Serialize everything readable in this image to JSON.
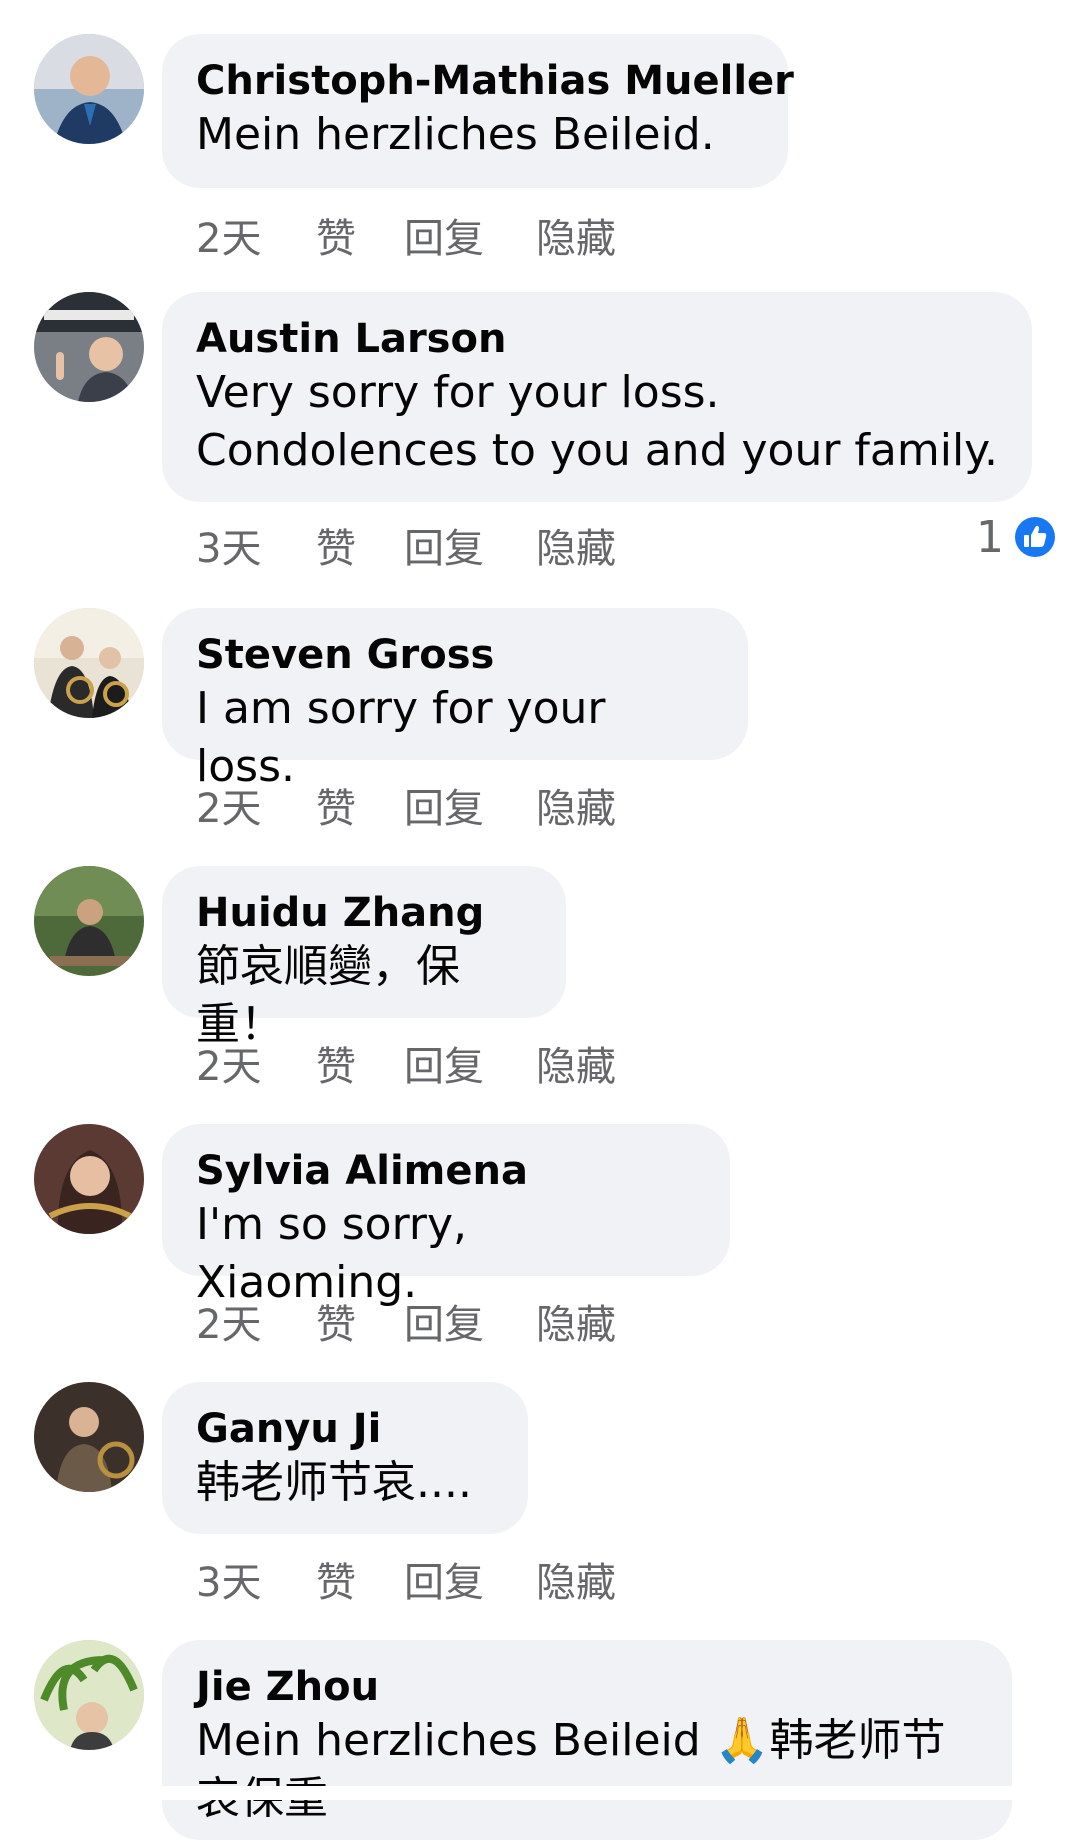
{
  "comments": [
    {
      "author": "Christoph-Mathias Mueller",
      "text": "Mein herzliches Beileid.",
      "time": "2天",
      "like": "赞",
      "reply": "回复",
      "hide": "隐藏"
    },
    {
      "author": "Austin Larson",
      "text": "Very sorry for your loss.\nCondolences to you and your family.",
      "time": "3天",
      "like": "赞",
      "reply": "回复",
      "hide": "隐藏",
      "reaction_count": "1"
    },
    {
      "author": "Steven Gross",
      "text": "I am sorry for your loss.",
      "time": "2天",
      "like": "赞",
      "reply": "回复",
      "hide": "隐藏"
    },
    {
      "author": "Huidu Zhang",
      "text": "節哀順變，保重！",
      "time": "2天",
      "like": "赞",
      "reply": "回复",
      "hide": "隐藏"
    },
    {
      "author": "Sylvia Alimena",
      "text": "I'm so sorry, Xiaoming.",
      "time": "2天",
      "like": "赞",
      "reply": "回复",
      "hide": "隐藏"
    },
    {
      "author": "Ganyu Ji",
      "text": "韩老师节哀....",
      "time": "3天",
      "like": "赞",
      "reply": "回复",
      "hide": "隐藏"
    },
    {
      "author": "Jie Zhou",
      "text": "Mein herzliches Beileid 🙏韩老师节\n哀保重"
    }
  ],
  "colors": {
    "bubble": "#f0f2f5",
    "meta_text": "#65676b",
    "like_blue": "#1877f2"
  },
  "icons": {
    "reaction": "like-thumb-icon",
    "emoji": "folded-hands"
  }
}
